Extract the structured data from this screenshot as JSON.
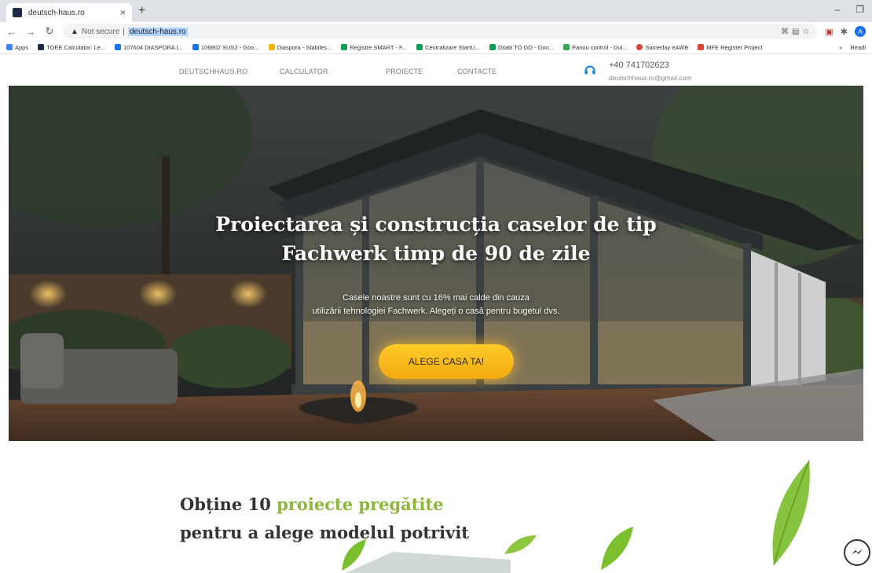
{
  "browser": {
    "tab_title": "deutsch-haus.ro",
    "tab_close": "×",
    "new_tab": "+",
    "security_label": "Not secure",
    "url": "deutsch-haus.ro",
    "avatar_letter": "A"
  },
  "bookmarks": [
    {
      "label": "Apps",
      "color": "#4285f4"
    },
    {
      "label": "TOEE Calculator: Le...",
      "color": "#1f2a44"
    },
    {
      "label": "107604 DIASPORA I...",
      "color": "#1a73e8"
    },
    {
      "label": "106802 SUS2 - Goo...",
      "color": "#1a73e8"
    },
    {
      "label": "Diaspora - Stabiles...",
      "color": "#f4b400"
    },
    {
      "label": "Registre SMART - F...",
      "color": "#0f9d58"
    },
    {
      "label": "Centralizare StartU...",
      "color": "#0f9d58"
    },
    {
      "label": "Dilatii TO DO - Goo...",
      "color": "#0f9d58"
    },
    {
      "label": "Panou control - Dul...",
      "color": "#34a853"
    },
    {
      "label": "Sameday eAWB",
      "color": "#db4437"
    },
    {
      "label": "MFE Register Project",
      "color": "#db4437"
    }
  ],
  "bookmarks_right": {
    "more": "»",
    "reading_list": "Readi"
  },
  "nav": {
    "links": [
      "DEUTSCHHAUS.RO",
      "CALCULATOR",
      "PROIECTE",
      "CONTACTE"
    ],
    "phone": "+40 741702623",
    "email": "deutschhaus.ro@gmail.com"
  },
  "hero": {
    "title_line1": "Proiectarea și construcția caselor de tip",
    "title_line2": "Fachwerk timp de 90 de zile",
    "subtitle_line1": "Casele noastre sunt cu 16% mai calde din cauza",
    "subtitle_line2": "utilizării  tehnologiei Fachwerk. Alegeți o casă pentru bugetul dvs.",
    "cta_label": "ALEGE CASA TA!"
  },
  "promo": {
    "line1_prefix": "Obține 10 ",
    "line1_highlight": "proiecte pregătite",
    "line2": "pentru a alege modelul potrivit"
  },
  "colors": {
    "accent_yellow": "#f3a911",
    "highlight_green": "#8cb63c"
  }
}
